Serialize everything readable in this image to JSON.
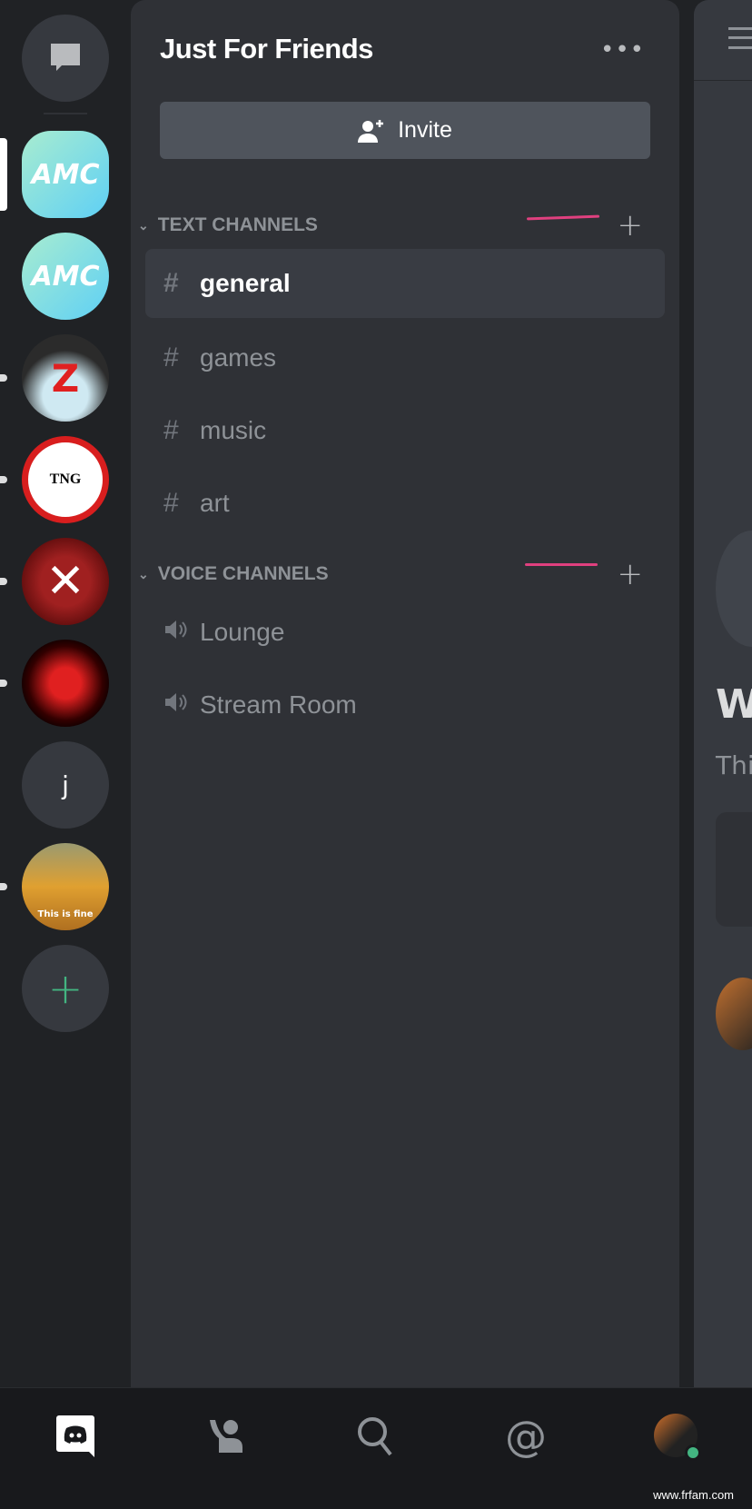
{
  "server_rail": {
    "servers": [
      {
        "name": "AMC",
        "label": "AMC"
      },
      {
        "name": "AMC",
        "label": "AMC"
      },
      {
        "name": "Z",
        "label": "Z"
      },
      {
        "name": "TNG",
        "label": "TNG"
      },
      {
        "name": "crossed",
        "label": ""
      },
      {
        "name": "bowser",
        "label": ""
      },
      {
        "name": "j",
        "label": "j"
      },
      {
        "name": "this-is-fine",
        "label": "This is fine"
      }
    ]
  },
  "server": {
    "title": "Just For Friends",
    "invite_label": "Invite"
  },
  "categories": [
    {
      "label": "TEXT CHANNELS",
      "channels": [
        "general",
        "games",
        "music",
        "art"
      ]
    },
    {
      "label": "VOICE CHANNELS",
      "channels": [
        "Lounge",
        "Stream Room"
      ]
    }
  ],
  "right_pane": {
    "heading_partial": "W",
    "text_partial": "Thi"
  },
  "colors": {
    "accent": "#43b581",
    "annotation": "#e0407f",
    "online": "#43b581"
  },
  "watermark": "www.frfam.com"
}
